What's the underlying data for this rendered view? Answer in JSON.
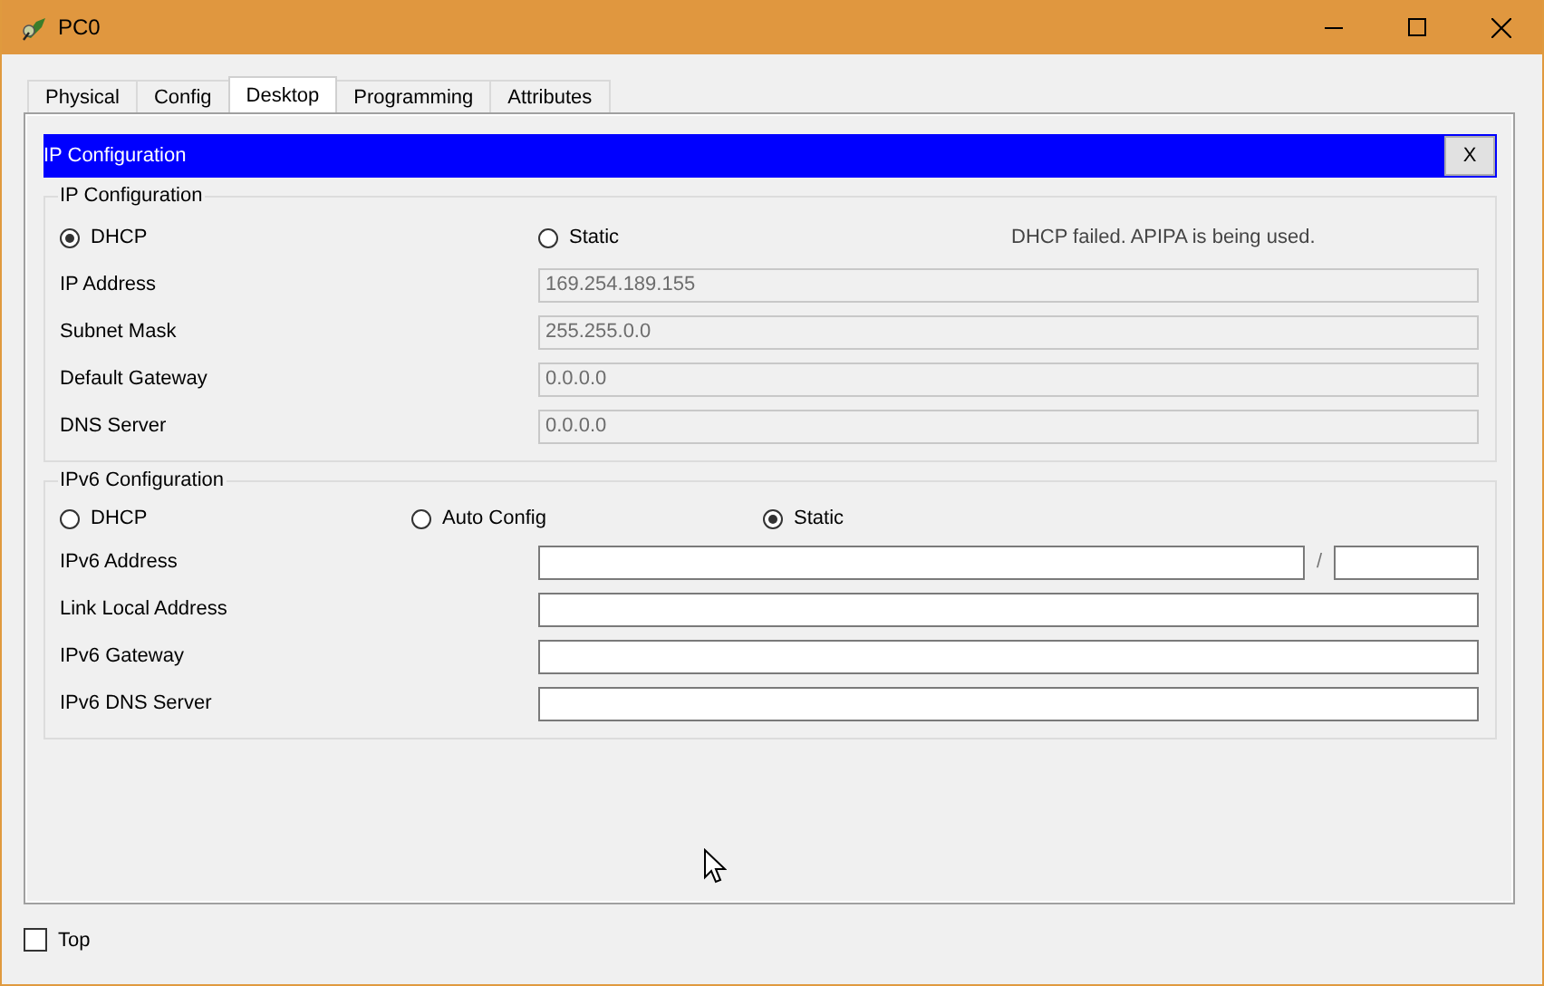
{
  "window": {
    "title": "PC0"
  },
  "tabs": [
    {
      "label": "Physical",
      "selected": false
    },
    {
      "label": "Config",
      "selected": false
    },
    {
      "label": "Desktop",
      "selected": true
    },
    {
      "label": "Programming",
      "selected": false
    },
    {
      "label": "Attributes",
      "selected": false
    }
  ],
  "dialog": {
    "title": "IP Configuration",
    "close": "X"
  },
  "ipv4": {
    "title": "IP Configuration",
    "modes": [
      {
        "label": "DHCP",
        "selected": true
      },
      {
        "label": "Static",
        "selected": false
      }
    ],
    "status": "DHCP failed. APIPA is being used.",
    "fields": [
      {
        "label": "IP Address",
        "value": "169.254.189.155",
        "disabled": true
      },
      {
        "label": "Subnet Mask",
        "value": "255.255.0.0",
        "disabled": true
      },
      {
        "label": "Default Gateway",
        "value": "0.0.0.0",
        "disabled": true
      },
      {
        "label": "DNS Server",
        "value": "0.0.0.0",
        "disabled": true
      }
    ]
  },
  "ipv6": {
    "title": "IPv6 Configuration",
    "modes": [
      {
        "label": "DHCP",
        "selected": false
      },
      {
        "label": "Auto Config",
        "selected": false
      },
      {
        "label": "Static",
        "selected": true
      }
    ],
    "fields": [
      {
        "label": "IPv6 Address",
        "kind": "prefix",
        "separator": "/",
        "disabled": false
      },
      {
        "label": "Link Local Address",
        "kind": "plain",
        "disabled": false
      },
      {
        "label": "IPv6 Gateway",
        "kind": "plain",
        "disabled": false
      },
      {
        "label": "IPv6 DNS Server",
        "kind": "plain",
        "disabled": false
      }
    ]
  },
  "top": {
    "label": "Top",
    "checked": false
  }
}
